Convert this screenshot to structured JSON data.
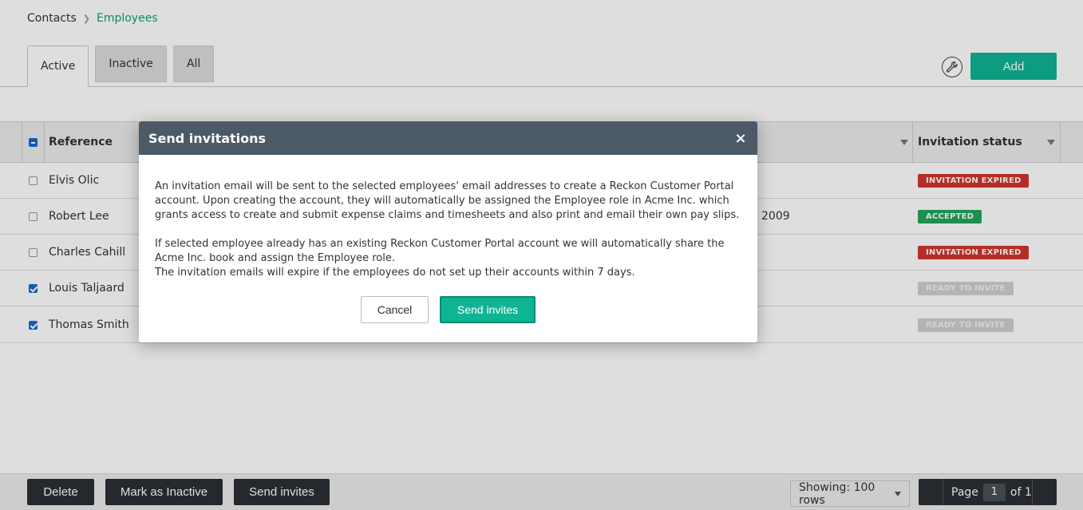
{
  "breadcrumb": {
    "parent": "Contacts",
    "current": "Employees"
  },
  "tabs": [
    {
      "label": "Active"
    },
    {
      "label": "Inactive"
    },
    {
      "label": "All"
    }
  ],
  "toolbar": {
    "add_label": "Add"
  },
  "table": {
    "columns": {
      "reference": "Reference",
      "invitation_status": "Invitation status"
    },
    "rows": [
      {
        "name": "Elvis Olic",
        "checked": false,
        "extra": "",
        "status": "INVITATION EXPIRED",
        "status_type": "expired"
      },
      {
        "name": "Robert Lee",
        "checked": false,
        "extra": "2009",
        "status": "ACCEPTED",
        "status_type": "accepted"
      },
      {
        "name": "Charles Cahill",
        "checked": false,
        "extra": "",
        "status": "INVITATION EXPIRED",
        "status_type": "expired"
      },
      {
        "name": "Louis Taljaard",
        "checked": true,
        "extra": "",
        "status": "READY TO INVITE",
        "status_type": "ready"
      },
      {
        "name": "Thomas Smith",
        "checked": true,
        "extra": "",
        "status": "READY TO INVITE",
        "status_type": "ready"
      }
    ]
  },
  "bottombar": {
    "delete_label": "Delete",
    "mark_inactive_label": "Mark as Inactive",
    "send_invites_label": "Send invites",
    "rows_select": "Showing: 100 rows",
    "page_label": "Page",
    "page_value": "1",
    "page_of": "of 1"
  },
  "modal": {
    "title": "Send invitations",
    "close_symbol": "×",
    "paragraph1": "An invitation email will be sent to the selected employees' email addresses to create a Reckon Customer Portal account. Upon creating the account, they will automatically be assigned the Employee role in Acme Inc. which grants access to create and submit expense claims and timesheets and also print and email their own pay slips.",
    "paragraph2": "If selected employee already has an existing Reckon Customer Portal account we will automatically share the Acme Inc. book and assign the Employee role.",
    "paragraph3": "The invitation emails will expire if the employees do not set up their accounts within 7 days.",
    "cancel_label": "Cancel",
    "send_label": "Send invites"
  },
  "colors": {
    "accent": "#0fb494",
    "link": "#0e9f7e",
    "header_bg": "#4c5a67",
    "expired": "#d0342c",
    "accepted": "#22a55a",
    "dark_button": "#2b2f33"
  },
  "icons": {
    "tool": "wrench-icon",
    "close": "close-icon",
    "filter": "filter-icon",
    "breadcrumb_sep": "chevron-right-icon"
  }
}
